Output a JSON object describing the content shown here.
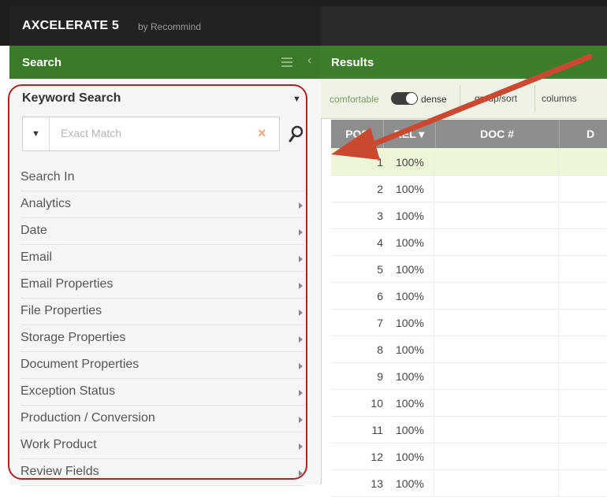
{
  "app": {
    "title": "AXCELERATE 5",
    "by": "by Recommind"
  },
  "left_panel": {
    "header": "Search",
    "keyword_search_label": "Keyword Search",
    "search_input": {
      "placeholder": "Exact Match",
      "value": ""
    },
    "menu_items": [
      "Search In",
      "Analytics",
      "Date",
      "Email",
      "Email Properties",
      "File Properties",
      "Storage Properties",
      "Document Properties",
      "Exception Status",
      "Production / Conversion",
      "Work Product",
      "Review Fields"
    ]
  },
  "right_panel": {
    "header": "Results",
    "view": {
      "comfortable": "comfortable",
      "dense": "dense",
      "dense_selected": true,
      "group_sort": "group/sort",
      "columns": "columns"
    },
    "columns": [
      "POS",
      "REL ▾",
      "DOC #",
      "D"
    ],
    "rows": [
      {
        "pos": "1",
        "rel": "100%"
      },
      {
        "pos": "2",
        "rel": "100%"
      },
      {
        "pos": "3",
        "rel": "100%"
      },
      {
        "pos": "4",
        "rel": "100%"
      },
      {
        "pos": "5",
        "rel": "100%"
      },
      {
        "pos": "6",
        "rel": "100%"
      },
      {
        "pos": "7",
        "rel": "100%"
      },
      {
        "pos": "8",
        "rel": "100%"
      },
      {
        "pos": "9",
        "rel": "100%"
      },
      {
        "pos": "10",
        "rel": "100%"
      },
      {
        "pos": "11",
        "rel": "100%"
      },
      {
        "pos": "12",
        "rel": "100%"
      },
      {
        "pos": "13",
        "rel": "100%"
      }
    ]
  },
  "colors": {
    "header_green": "#3a7a2a",
    "annotation_red": "#b42323",
    "grid_header_gray": "#8e8e8e",
    "selected_row": "#eef6d8"
  }
}
